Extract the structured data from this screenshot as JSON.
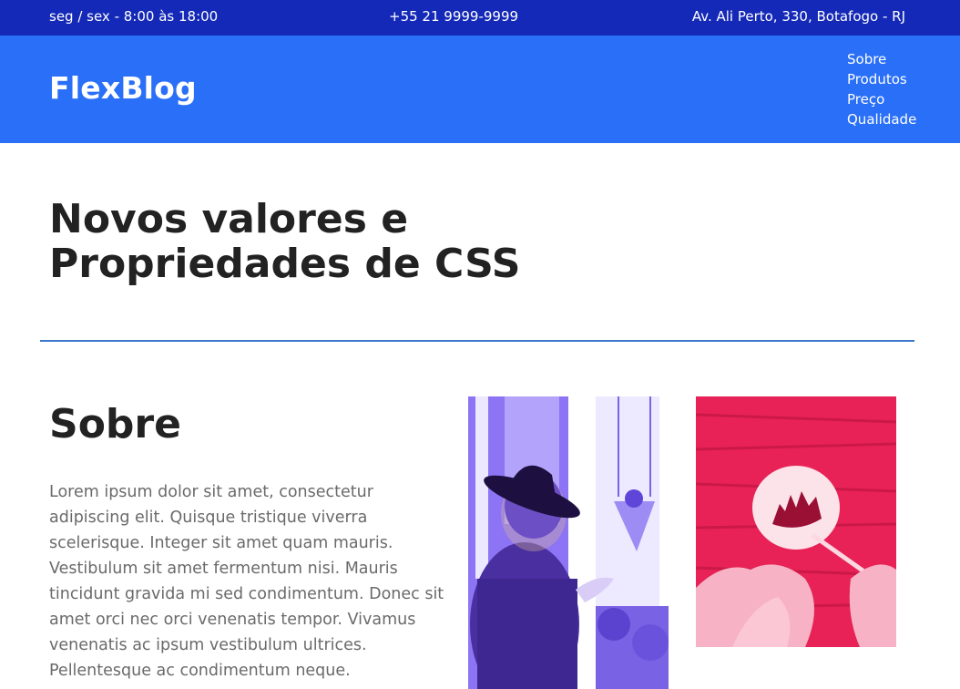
{
  "topbar": {
    "hours": "seg / sex - 8:00 às 18:00",
    "phone": "+55 21 9999-9999",
    "address": "Av. Ali Perto, 330, Botafogo - RJ"
  },
  "header": {
    "logo": "FlexBlog",
    "nav": [
      "Sobre",
      "Produtos",
      "Preço",
      "Qualidade"
    ]
  },
  "hero": {
    "title_line1": "Novos valores e",
    "title_line2": "Propriedades de CSS"
  },
  "about": {
    "title": "Sobre",
    "text": "Lorem ipsum dolor sit amet, consectetur adipiscing elit. Quisque tristique viverra scelerisque. Integer sit amet quam mauris. Vestibulum sit amet fermentum nisi. Mauris tincidunt gravida mi sed condimentum. Donec sit amet orci nec orci venenatis tempor. Vivamus venenatis ac ipsum vestibulum ultrices. Pellentesque ac condimentum neque."
  },
  "colors": {
    "topbar": "#1429b7",
    "header": "#2a6ff8",
    "divider": "#3a77cc",
    "image1_tint": "#6a4cf0",
    "image2_tint": "#e82256"
  }
}
